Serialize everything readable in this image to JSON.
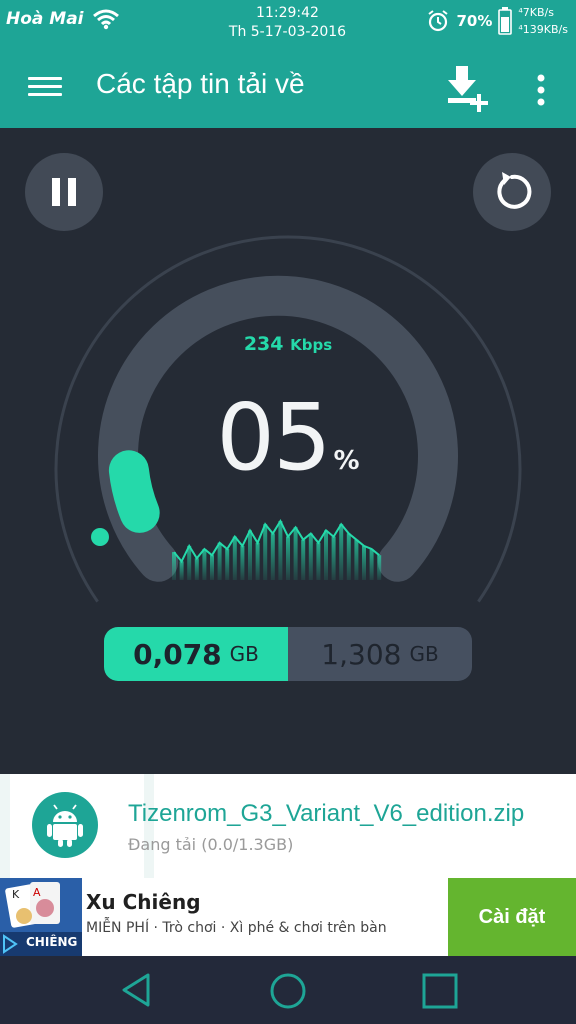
{
  "status_bar": {
    "carrier": "Hoà Mai",
    "time": "11:29:42",
    "date": "Th 5-17-03-2016",
    "battery": "70%",
    "upload_speed": "⁴7KB/s",
    "download_speed": "⁴139KB/s"
  },
  "app_bar": {
    "title": "Các tập tin tải về"
  },
  "download": {
    "speed_value": "234",
    "speed_unit": "Kbps",
    "percent": "05",
    "percent_symbol": "%",
    "progress_fraction": 0.05,
    "downloaded_value": "0,078",
    "downloaded_unit": "GB",
    "total_value": "1,308",
    "total_unit": "GB"
  },
  "file": {
    "name": "Tizenrom_G3_Variant_V6_edition.zip",
    "status": "Đang tải (0.0/1.3GB)"
  },
  "ad": {
    "title": "Xu Chiêng",
    "subtitle": "MIỄN PHÍ · Trò chơi · Xì phé & chơi trên bàn",
    "button_label": "Cài đặt",
    "icon_label": "CHIÊNG"
  },
  "colors": {
    "accent": "#1ea596",
    "progress": "#25d9aa",
    "background": "#252b35",
    "install": "#64b52f"
  }
}
